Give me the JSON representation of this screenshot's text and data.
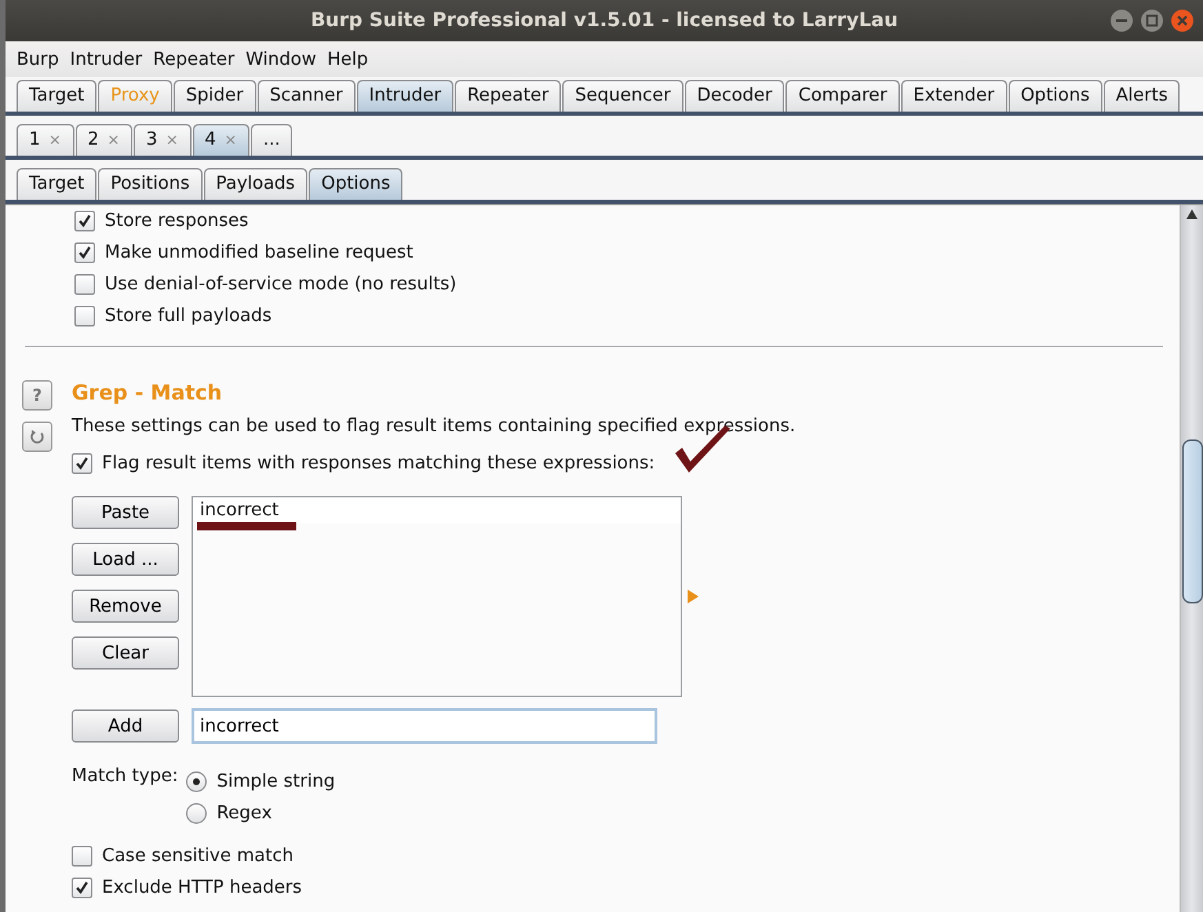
{
  "window": {
    "title": "Burp Suite Professional v1.5.01 - licensed to LarryLau"
  },
  "menu": [
    "Burp",
    "Intruder",
    "Repeater",
    "Window",
    "Help"
  ],
  "tabs": [
    {
      "label": "Target",
      "selected": false,
      "highlighted": false
    },
    {
      "label": "Proxy",
      "selected": false,
      "highlighted": true
    },
    {
      "label": "Spider",
      "selected": false,
      "highlighted": false
    },
    {
      "label": "Scanner",
      "selected": false,
      "highlighted": false
    },
    {
      "label": "Intruder",
      "selected": true,
      "highlighted": false
    },
    {
      "label": "Repeater",
      "selected": false,
      "highlighted": false
    },
    {
      "label": "Sequencer",
      "selected": false,
      "highlighted": false
    },
    {
      "label": "Decoder",
      "selected": false,
      "highlighted": false
    },
    {
      "label": "Comparer",
      "selected": false,
      "highlighted": false
    },
    {
      "label": "Extender",
      "selected": false,
      "highlighted": false
    },
    {
      "label": "Options",
      "selected": false,
      "highlighted": false
    },
    {
      "label": "Alerts",
      "selected": false,
      "highlighted": false
    }
  ],
  "attack_tabs": [
    {
      "label": "1",
      "close": "×",
      "selected": false
    },
    {
      "label": "2",
      "close": "×",
      "selected": false
    },
    {
      "label": "3",
      "close": "×",
      "selected": false
    },
    {
      "label": "4",
      "close": "×",
      "selected": true
    },
    {
      "label": "...",
      "selected": false
    }
  ],
  "sub_tabs": [
    {
      "label": "Target",
      "selected": false
    },
    {
      "label": "Positions",
      "selected": false
    },
    {
      "label": "Payloads",
      "selected": false
    },
    {
      "label": "Options",
      "selected": true
    }
  ],
  "options": [
    {
      "label": "Store responses",
      "checked": true
    },
    {
      "label": "Make unmodified baseline request",
      "checked": true
    },
    {
      "label": "Use denial-of-service mode (no results)",
      "checked": false
    },
    {
      "label": "Store full payloads",
      "checked": false
    }
  ],
  "grep_match": {
    "help_button": "?",
    "title": "Grep - Match",
    "description": "These settings can be used to flag result items containing specified expressions.",
    "flag": {
      "label": "Flag result items with responses matching these expressions:",
      "checked": true
    },
    "buttons": [
      "Paste",
      "Load ...",
      "Remove",
      "Clear"
    ],
    "list": [
      "incorrect"
    ],
    "add_button": "Add",
    "input": {
      "value": "incorrect"
    },
    "match_type": {
      "label": "Match type:",
      "options": [
        {
          "label": "Simple string",
          "selected": true
        },
        {
          "label": "Regex",
          "selected": false
        }
      ]
    },
    "checkboxes": [
      {
        "label": "Case sensitive match",
        "checked": false
      },
      {
        "label": "Exclude HTTP headers",
        "checked": true
      }
    ]
  }
}
